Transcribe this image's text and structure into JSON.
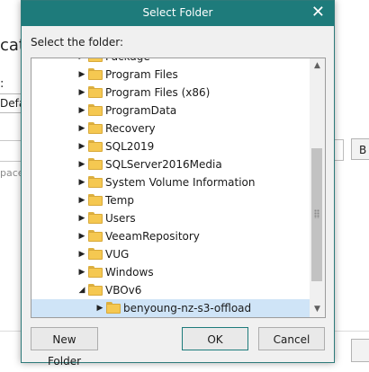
{
  "background": {
    "title_fragment": "catio",
    "label_fragment": ":",
    "field_fragment": "Defa",
    "placeholder_fragment": "pace",
    "right_button_fragment": "B"
  },
  "dialog": {
    "title": "Select Folder",
    "close_glyph": "✕",
    "prompt": "Select the folder:",
    "tree_items": [
      {
        "label": "Package",
        "depth": 0,
        "expanded": false,
        "selected": false
      },
      {
        "label": "Program Files",
        "depth": 0,
        "expanded": false,
        "selected": false
      },
      {
        "label": "Program Files (x86)",
        "depth": 0,
        "expanded": false,
        "selected": false
      },
      {
        "label": "ProgramData",
        "depth": 0,
        "expanded": false,
        "selected": false
      },
      {
        "label": "Recovery",
        "depth": 0,
        "expanded": false,
        "selected": false
      },
      {
        "label": "SQL2019",
        "depth": 0,
        "expanded": false,
        "selected": false
      },
      {
        "label": "SQLServer2016Media",
        "depth": 0,
        "expanded": false,
        "selected": false
      },
      {
        "label": "System Volume Information",
        "depth": 0,
        "expanded": false,
        "selected": false
      },
      {
        "label": "Temp",
        "depth": 0,
        "expanded": false,
        "selected": false
      },
      {
        "label": "Users",
        "depth": 0,
        "expanded": false,
        "selected": false
      },
      {
        "label": "VeeamRepository",
        "depth": 0,
        "expanded": false,
        "selected": false
      },
      {
        "label": "VUG",
        "depth": 0,
        "expanded": false,
        "selected": false
      },
      {
        "label": "Windows",
        "depth": 0,
        "expanded": false,
        "selected": false
      },
      {
        "label": "VBOv6",
        "depth": 0,
        "expanded": true,
        "selected": false
      },
      {
        "label": "benyoung-nz-s3-offload",
        "depth": 1,
        "expanded": false,
        "selected": true
      }
    ],
    "icons": {
      "collapsed": "▶",
      "expanded": "◢",
      "scroll_up": "▲",
      "scroll_down": "▼"
    },
    "buttons": {
      "new_folder": "New Folder",
      "ok": "OK",
      "cancel": "Cancel"
    },
    "colors": {
      "titlebar": "#1e7b7b",
      "selection": "#cfe4f7",
      "folder": "#f5c851"
    }
  }
}
